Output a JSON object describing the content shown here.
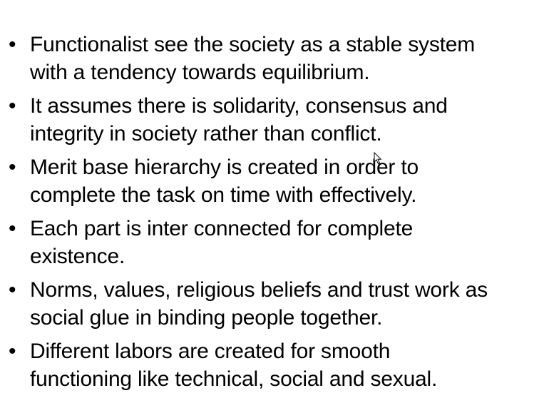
{
  "slide": {
    "bullet_symbol": "•",
    "bullets": [
      {
        "line1": "Functionalist see the society as a stable system",
        "line2": "with a tendency towards equilibrium."
      },
      {
        "line1": "It assumes there is solidarity, consensus and",
        "line2": "integrity in society rather than conflict."
      },
      {
        "line1": "Merit base hierarchy is created in order to",
        "line2": "complete the task on time with effectively."
      },
      {
        "line1": "Each part is inter connected for complete",
        "line2": "existence."
      },
      {
        "line1": "Norms, values, religious beliefs and trust work as",
        "line2": "social glue in binding people together."
      },
      {
        "line1": "Different labors are created for smooth",
        "line2": "functioning like technical, social and sexual."
      }
    ]
  }
}
